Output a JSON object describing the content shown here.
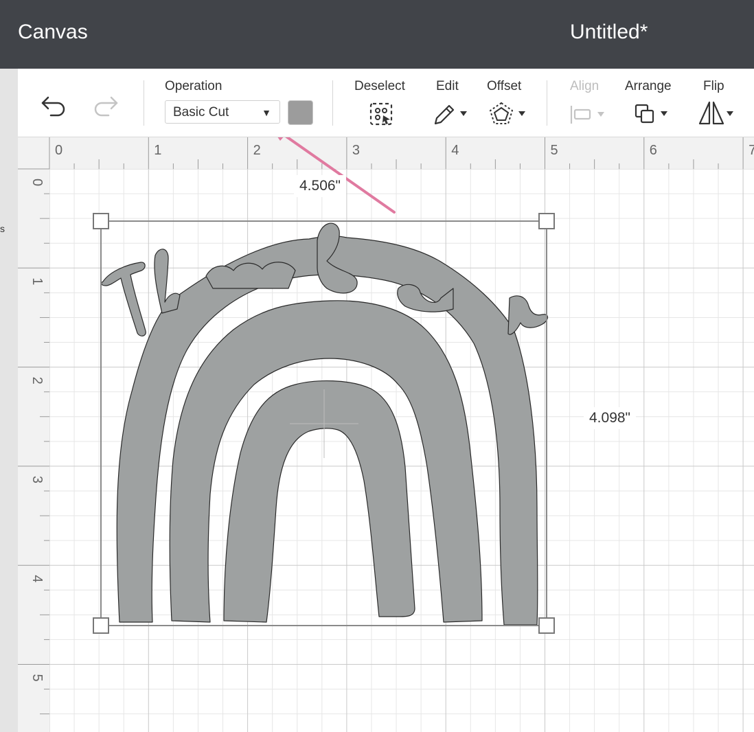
{
  "header": {
    "app_title": "Canvas",
    "document_title": "Untitled*",
    "background_color": "#414449"
  },
  "left_strip": {
    "glyph": "s"
  },
  "toolbar": {
    "undo_icon": "undo-arrow-icon",
    "redo_icon": "redo-arrow-icon",
    "operation": {
      "label": "Operation",
      "value": "Basic Cut",
      "color": "#9c9c9c"
    },
    "deselect": {
      "label": "Deselect",
      "icon": "deselect-dashed-box-icon"
    },
    "edit": {
      "label": "Edit",
      "icon": "pencil-icon"
    },
    "offset": {
      "label": "Offset",
      "icon": "offset-pentagon-icon"
    },
    "align": {
      "label": "Align",
      "icon": "align-icon",
      "enabled": false
    },
    "arrange": {
      "label": "Arrange",
      "icon": "arrange-layers-icon"
    },
    "flip": {
      "label": "Flip",
      "icon": "flip-triangles-icon"
    }
  },
  "rulers": {
    "horizontal": [
      "0",
      "1",
      "2",
      "3",
      "4",
      "5",
      "6",
      "7"
    ],
    "vertical": [
      "0",
      "1",
      "2",
      "3",
      "4",
      "5"
    ],
    "unit": "in"
  },
  "selection": {
    "width_label": "4.506\"",
    "height_label": "4.098\"",
    "shape_color": "#9ea1a1"
  },
  "annotation": {
    "arrow_color": "#e07aa0",
    "arrow_target": "operation-dropdown"
  }
}
